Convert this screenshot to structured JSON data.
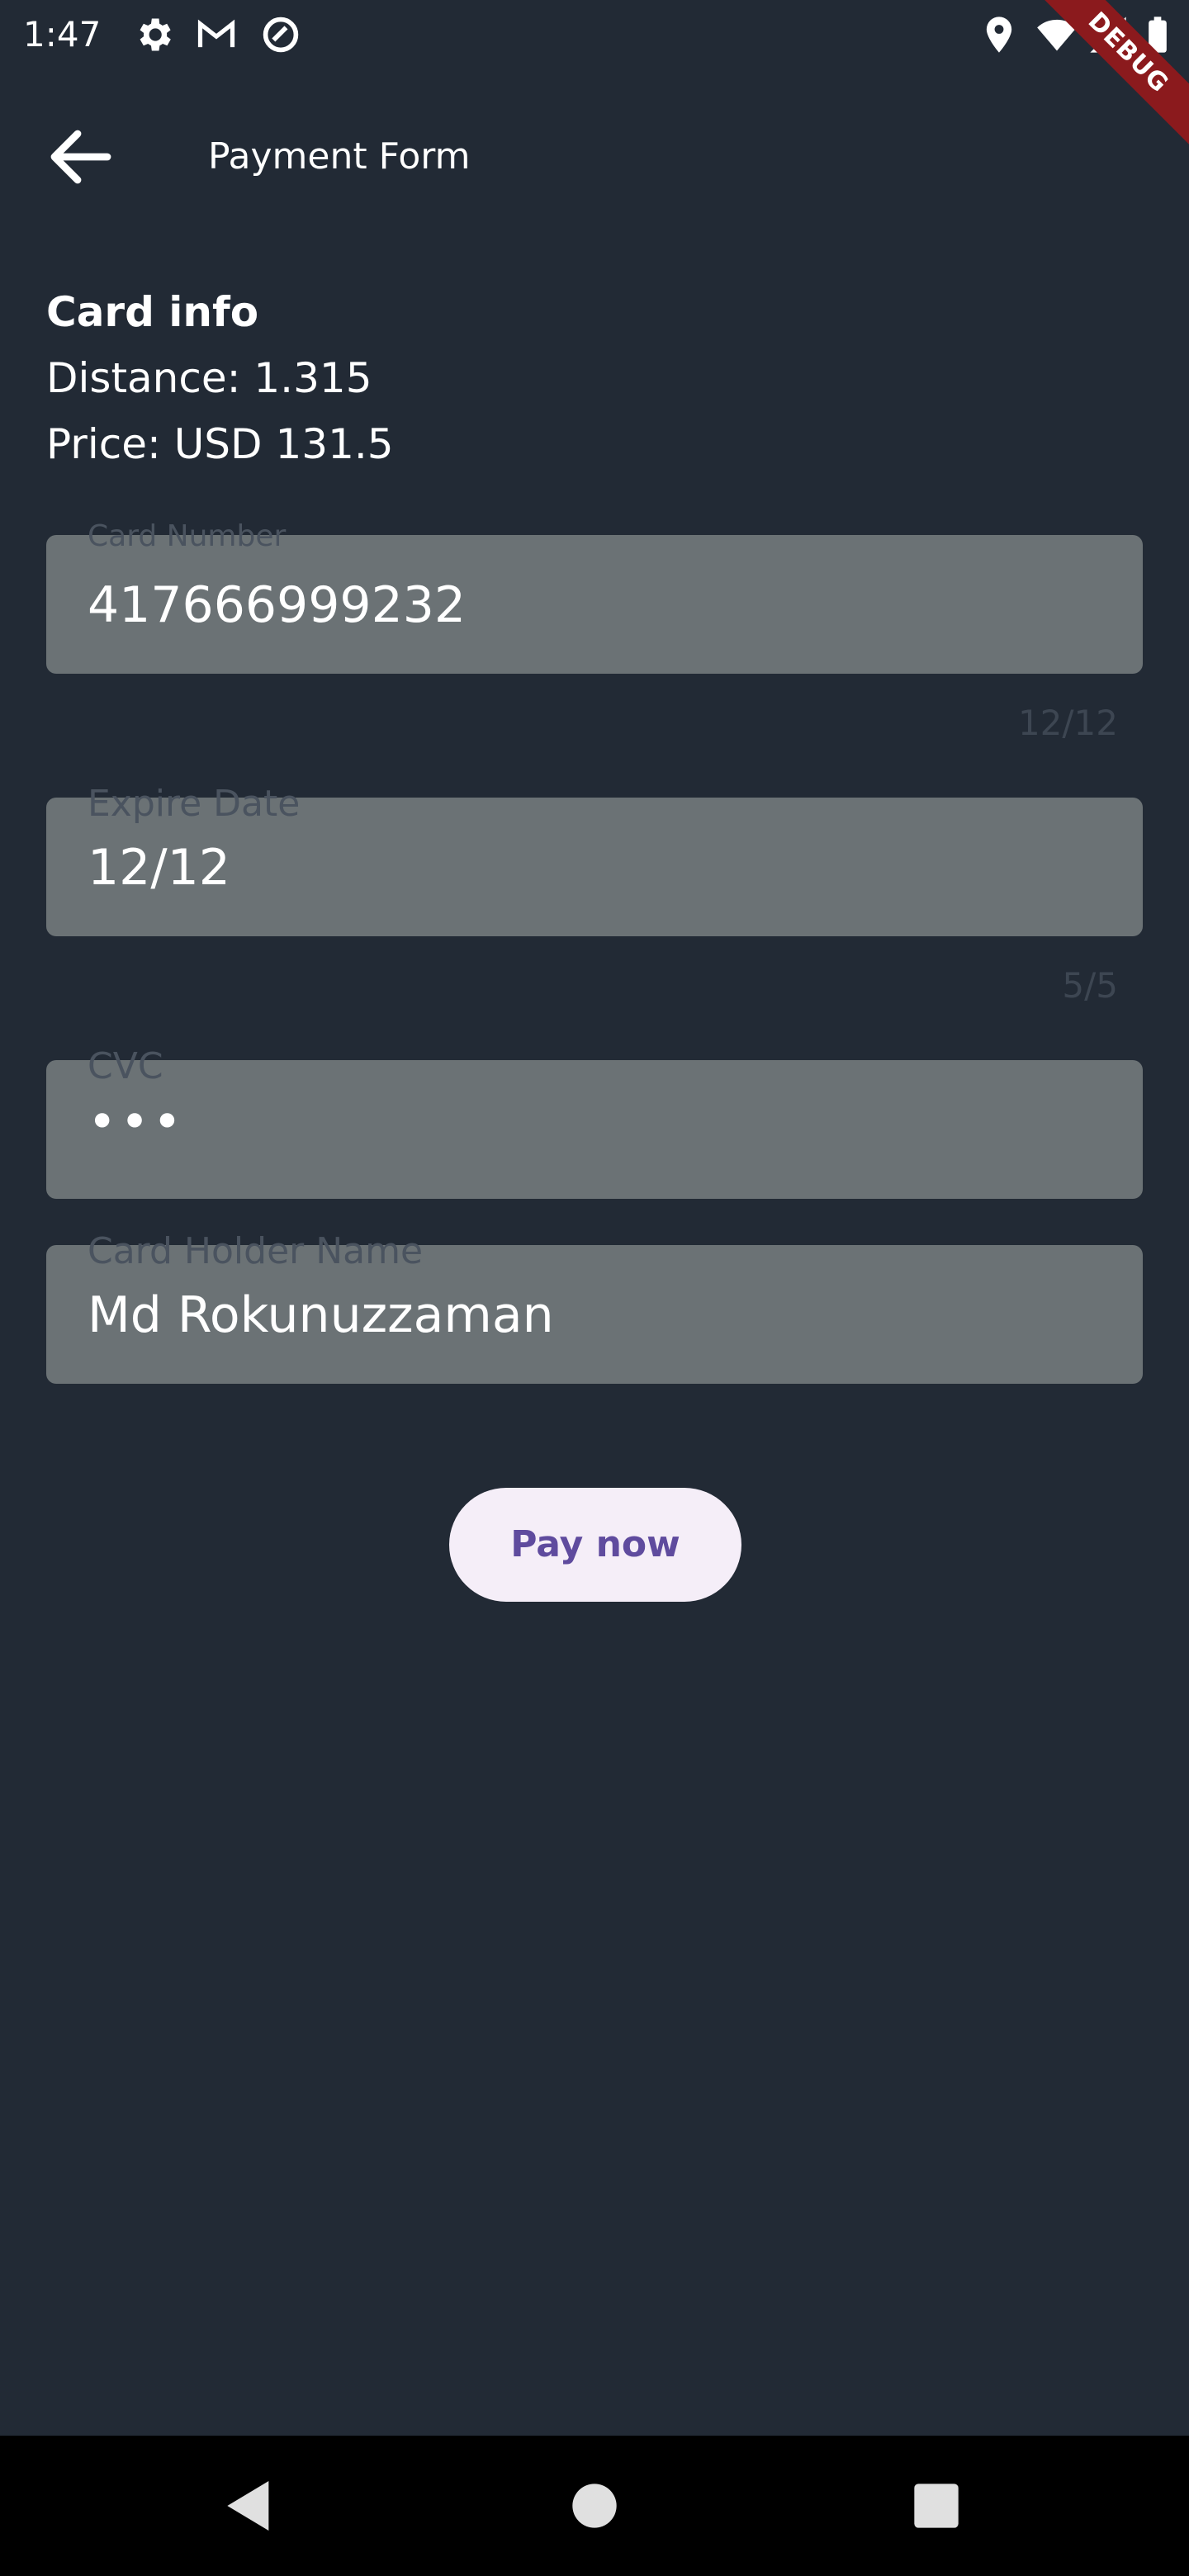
{
  "status_bar": {
    "time": "1:47",
    "icons": [
      "settings-icon",
      "gmail-icon",
      "sync-icon",
      "location-icon",
      "wifi-icon",
      "signal-icon",
      "battery-icon"
    ]
  },
  "debug_banner": "DEBUG",
  "app_bar": {
    "title": "Payment Form",
    "back_icon": "arrow-back-icon"
  },
  "card_info": {
    "heading": "Card info",
    "distance": "Distance: 1.315",
    "price": "Price: USD 131.5"
  },
  "fields": {
    "card_number": {
      "label": "Card Number",
      "value": "417666999232",
      "counter": "12/12"
    },
    "expire_date": {
      "label": "Expire Date",
      "value": "12/12",
      "counter": "5/5"
    },
    "cvc": {
      "label": "CVC",
      "value": "•••"
    },
    "card_holder": {
      "label": "Card Holder Name",
      "value": "Md Rokunuzzaman"
    }
  },
  "actions": {
    "pay_label": "Pay now"
  },
  "colors": {
    "background": "#222a35",
    "field_fill": "#6b7275",
    "button_fill": "#f5eef8",
    "button_text": "#5f4b9e",
    "debug_ribbon": "#8b1a1d"
  },
  "nav_bar": {
    "icons": [
      "back-triangle-icon",
      "home-circle-icon",
      "recents-square-icon"
    ]
  }
}
